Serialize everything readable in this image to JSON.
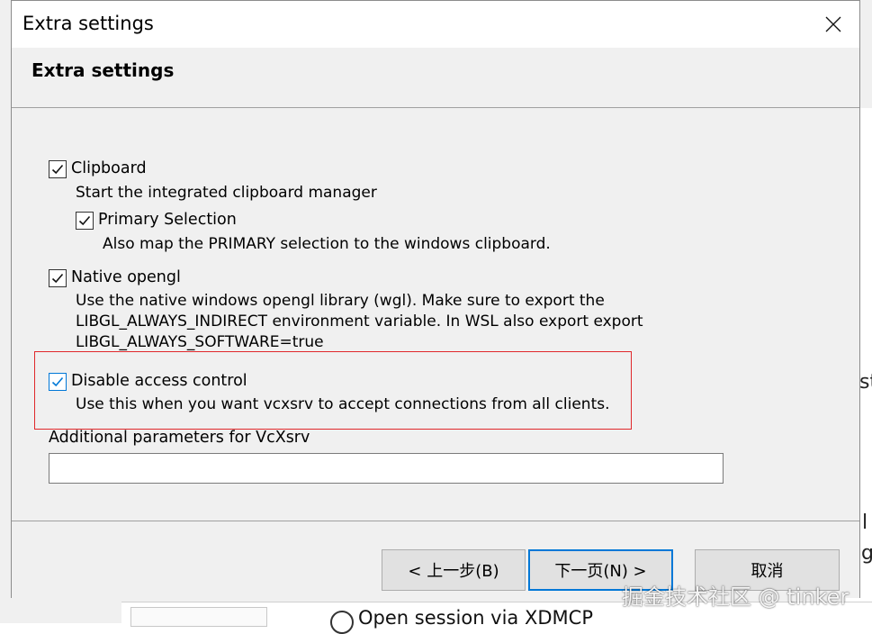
{
  "window": {
    "title": "Extra settings",
    "header_title": "Extra settings"
  },
  "options": {
    "clipboard": {
      "label": "Clipboard",
      "checked": true,
      "description": "Start the integrated clipboard manager"
    },
    "primary_selection": {
      "label": "Primary Selection",
      "checked": true,
      "description": "Also map the PRIMARY selection to the windows clipboard."
    },
    "native_opengl": {
      "label": "Native opengl",
      "checked": true,
      "description_lines": [
        "Use the native windows opengl library (wgl). Make sure to export the",
        "LIBGL_ALWAYS_INDIRECT environment variable. In WSL also export export",
        "LIBGL_ALWAYS_SOFTWARE=true"
      ]
    },
    "disable_access_control": {
      "label": "Disable access control",
      "checked": true,
      "description": "Use this when you want vcxsrv to accept connections from all clients."
    }
  },
  "additional_params": {
    "label": "Additional parameters for VcXsrv",
    "value": ""
  },
  "buttons": {
    "back": "< 上一步(B)",
    "next": "下一页(N) >",
    "cancel": "取消"
  },
  "background": {
    "radio_label": "Open session via XDMCP",
    "edge_fragments": [
      "st",
      "l",
      "g"
    ]
  },
  "watermark": "掘金技术社区 @ tinker",
  "colors": {
    "accent": "#0078d7",
    "highlight": "#e0282b",
    "dialog_bg": "#f0f0f0"
  }
}
